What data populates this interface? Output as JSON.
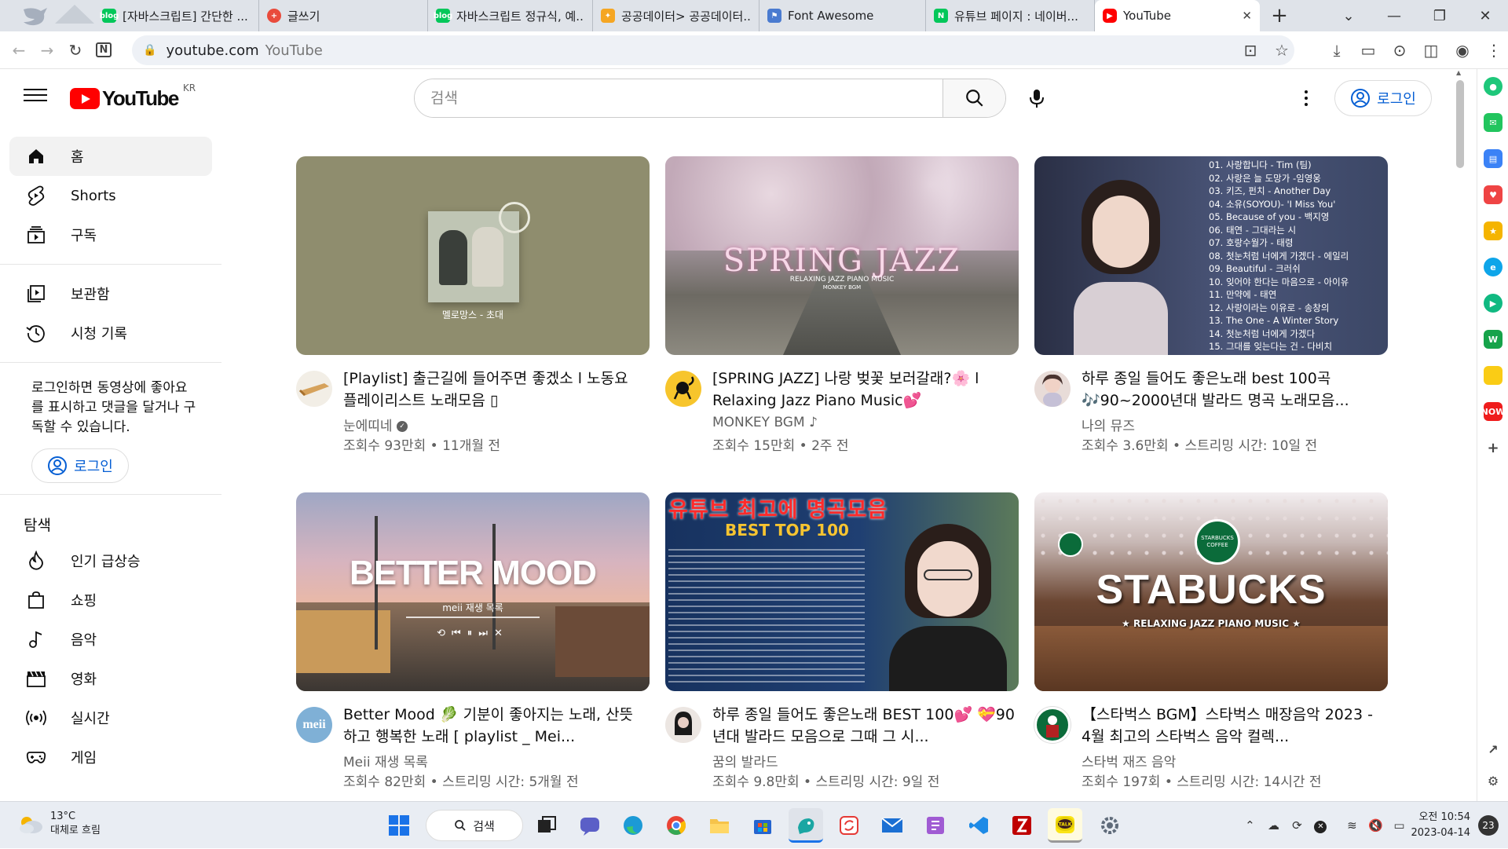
{
  "browser": {
    "tabs": [
      {
        "title": "[자바스크립트] 간단한 ...",
        "fav_color": "#03c75a",
        "fav_text": "blog"
      },
      {
        "title": "글쓰기",
        "fav_color": "#e94b3c",
        "fav_text": "+"
      },
      {
        "title": "자바스크립트 정규식, 예...",
        "fav_color": "#03c75a",
        "fav_text": "blog"
      },
      {
        "title": "공공데이터> 공공데이터...",
        "fav_color": "#f5a623",
        "fav_text": "✦"
      },
      {
        "title": "Font Awesome",
        "fav_color": "#4a7bd0",
        "fav_text": "⚑"
      },
      {
        "title": "유튜브 페이지 : 네이버...",
        "fav_color": "#03c75a",
        "fav_text": "N"
      },
      {
        "title": "YouTube",
        "fav_color": "#ff0000",
        "fav_text": "▶"
      }
    ],
    "url_host": "youtube.com",
    "url_title": "YouTube"
  },
  "header": {
    "logo_text": "YouTube",
    "logo_region": "KR",
    "search_placeholder": "검색",
    "signin_label": "로그인"
  },
  "sidebar": {
    "main": [
      {
        "label": "홈",
        "icon": "home-icon"
      },
      {
        "label": "Shorts",
        "icon": "shorts-icon"
      },
      {
        "label": "구독",
        "icon": "subscriptions-icon"
      }
    ],
    "library": [
      {
        "label": "보관함",
        "icon": "library-icon"
      },
      {
        "label": "시청 기록",
        "icon": "history-icon"
      }
    ],
    "signin_text": "로그인하면 동영상에 좋아요를 표시하고 댓글을 달거나 구독할 수 있습니다.",
    "signin_button": "로그인",
    "explore_title": "탐색",
    "explore": [
      {
        "label": "인기 급상승",
        "icon": "trending-icon"
      },
      {
        "label": "쇼핑",
        "icon": "shopping-icon"
      },
      {
        "label": "음악",
        "icon": "music-icon"
      },
      {
        "label": "영화",
        "icon": "movies-icon"
      },
      {
        "label": "실시간",
        "icon": "live-icon"
      },
      {
        "label": "게임",
        "icon": "gaming-icon"
      }
    ]
  },
  "videos": [
    {
      "title": "[Playlist] 출근길에 들어주면 좋겠소 l 노동요 플레이리스트 노래모음 ▯",
      "channel": "눈에띠네",
      "verified": true,
      "music_note": false,
      "stats": "조회수 93만회 • 11개월 전",
      "thumb_caption": "멜로망스 - 초대",
      "thumb_bg": "#8f8d6e"
    },
    {
      "title": "[SPRING JAZZ] 나랑 벚꽃 보러갈래?🌸 l Relaxing Jazz Piano Music💕",
      "channel": "MONKEY BGM",
      "verified": false,
      "music_note": true,
      "stats": "조회수 15만회 • 2주 전",
      "thumb_caption": "SPRING JAZZ",
      "thumb_subcaption": "RELAXING JAZZ PIANO MUSIC",
      "thumb_subcaption2": "MONKEY BGM",
      "thumb_bg": "#c9b9c2"
    },
    {
      "title": "하루 종일 들어도 좋은노래 best 100곡 🎶90~2000년대 발라드 명곡 노래모음...",
      "channel": "나의 뮤즈",
      "verified": false,
      "music_note": false,
      "stats": "조회수 3.6만회 • 스트리밍 시간: 10일 전",
      "thumb_bg": "#3a4566",
      "thumb_list": [
        "01. 사랑합니다 - Tim (팀)",
        "02. 사랑은 늘 도망가 -임영웅",
        "03. 키즈, 펀치 - Another Day",
        "04. 소유(SOYOU)- 'I Miss You'",
        "05. Because of you - 백지영",
        "06. 태연 - 그대라는 시",
        "07. 호랑수월가 - 태령",
        "08. 첫눈처럼 너에게 가겠다 - 에일리",
        "09. Beautiful - 크러쉬",
        "10. 잊어야 한다는 마음으로 - 아이유",
        "11. 만약에 - 태연",
        "12. 사랑이라는 이유로 - 송창의",
        "13. The One - A Winter Story",
        "14. 첫눈처럼 너에게 가겠다",
        "15. 그대를 잊는다는 건 - 다비치"
      ]
    },
    {
      "title": "Better Mood 🥬 기분이 좋아지는 노래, 산뜻하고 행복한 노래 [ playlist _ Mei...",
      "channel": "Meii 재생 목록",
      "verified": false,
      "music_note": false,
      "stats": "조회수 82만회 • 스트리밍 시간: 5개월 전",
      "thumb_caption": "BETTER MOOD",
      "thumb_subcaption": "meii 재생 목록",
      "thumb_bg": "#c4b3b8"
    },
    {
      "title": "하루 종일 들어도 좋은노래 BEST 100💕 💝90년대 발라드 모음으로 그때 그 시...",
      "channel": "꿈의 발라드",
      "verified": false,
      "music_note": false,
      "stats": "조회수 9.8만회 • 스트리밍 시간: 9일 전",
      "thumb_caption": "유튜브 최고에 명곡모음",
      "thumb_subcaption": "BEST TOP 100",
      "thumb_bg": "#17325f"
    },
    {
      "title": "【스타벅스 BGM】스타벅스 매장음악 2023 - 4월 최고의 스타벅스 음악 컬렉...",
      "channel": "스타벅 재즈 음악",
      "verified": false,
      "music_note": false,
      "stats": "조회수 197회 • 스트리밍 시간: 14시간 전",
      "thumb_caption": "STABUCKS",
      "thumb_subcaption": "RELAXING JAZZ PIANO MUSIC",
      "thumb_badge": "STARBUCKS COFFEE",
      "thumb_bg": "#6b4632"
    }
  ],
  "taskbar": {
    "weather_temp": "13°C",
    "weather_desc": "대체로 흐림",
    "search_label": "검색",
    "time": "오전 10:54",
    "date": "2023-04-14",
    "notifications": "23"
  },
  "colors": {
    "yt_red": "#ff0000",
    "link_blue": "#065fd4",
    "secondary_text": "#606060"
  }
}
